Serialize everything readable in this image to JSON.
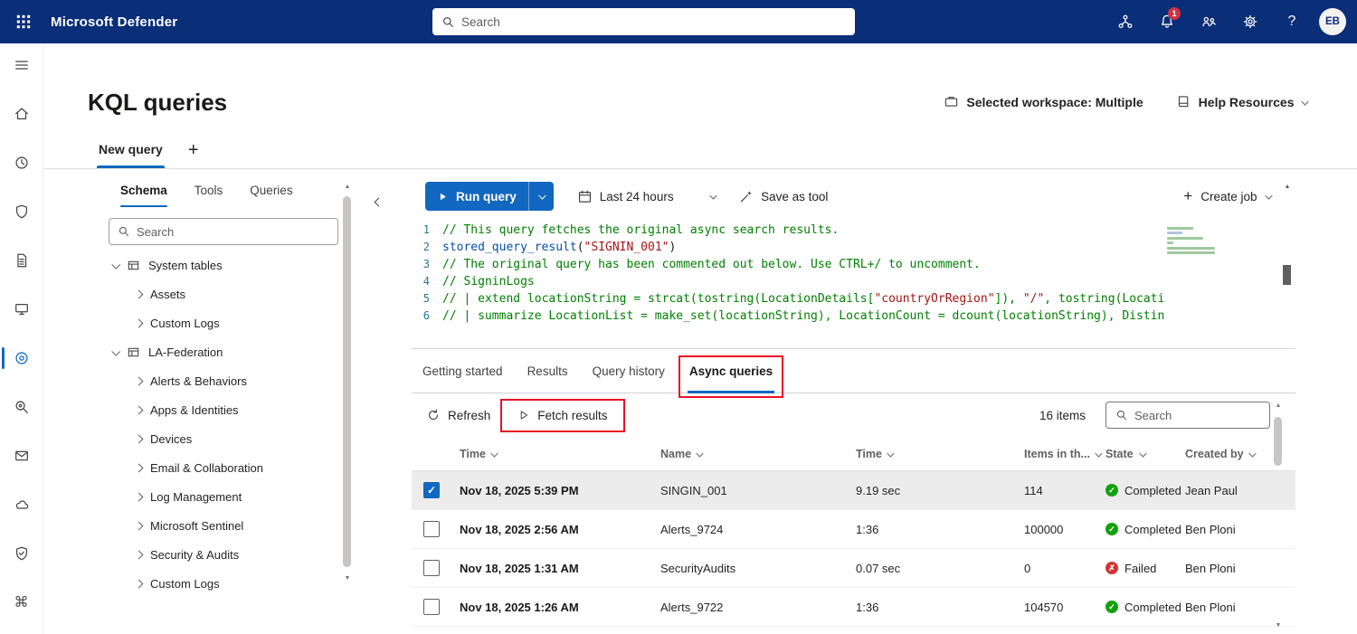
{
  "colors": {
    "header_bg": "#0a2e78",
    "primary": "#1267c1",
    "success": "#13a10e",
    "error": "#d13438",
    "annotation": "#e81123"
  },
  "topbar": {
    "app_title": "Microsoft Defender",
    "search_placeholder": "Search",
    "notification_badge": "1",
    "avatar_initials": "EB"
  },
  "page": {
    "title": "KQL queries",
    "workspace_label": "Selected workspace: Multiple",
    "help_label": "Help Resources",
    "query_tab": "New query"
  },
  "schema_panel": {
    "tabs": [
      {
        "label": "Schema",
        "active": true
      },
      {
        "label": "Tools",
        "active": false
      },
      {
        "label": "Queries",
        "active": false
      }
    ],
    "search_placeholder": "Search",
    "tree": [
      {
        "label": "System tables",
        "level": 1,
        "expanded": true,
        "group": true
      },
      {
        "label": "Assets",
        "level": 2,
        "expanded": false,
        "group": false
      },
      {
        "label": "Custom Logs",
        "level": 2,
        "expanded": false,
        "group": false
      },
      {
        "label": "LA-Federation",
        "level": 1,
        "expanded": true,
        "group": true
      },
      {
        "label": "Alerts & Behaviors",
        "level": 2,
        "expanded": false,
        "group": false
      },
      {
        "label": "Apps & Identities",
        "level": 2,
        "expanded": false,
        "group": false
      },
      {
        "label": "Devices",
        "level": 2,
        "expanded": false,
        "group": false
      },
      {
        "label": "Email & Collaboration",
        "level": 2,
        "expanded": false,
        "group": false
      },
      {
        "label": "Log Management",
        "level": 2,
        "expanded": false,
        "group": false
      },
      {
        "label": "Microsoft Sentinel",
        "level": 2,
        "expanded": false,
        "group": false
      },
      {
        "label": "Security & Audits",
        "level": 2,
        "expanded": false,
        "group": false
      },
      {
        "label": "Custom Logs",
        "level": 2,
        "expanded": false,
        "group": false
      }
    ]
  },
  "editor": {
    "run_query": "Run query",
    "time_range": "Last 24 hours",
    "save_as_tool": "Save as tool",
    "create_job": "Create job",
    "code_lines": [
      {
        "n": 1,
        "seg": [
          [
            "comment",
            "// This query fetches the original async search results."
          ]
        ]
      },
      {
        "n": 2,
        "seg": [
          [
            "function",
            "stored_query_result"
          ],
          [
            "plain",
            "("
          ],
          [
            "string",
            "\"SIGNIN_001\""
          ],
          [
            "plain",
            ")"
          ]
        ]
      },
      {
        "n": 3,
        "seg": [
          [
            "comment",
            "// The original query has been commented out below. Use CTRL+/ to uncomment."
          ]
        ]
      },
      {
        "n": 4,
        "seg": [
          [
            "comment",
            "// SigninLogs"
          ]
        ]
      },
      {
        "n": 5,
        "seg": [
          [
            "comment",
            "// | extend locationString = strcat(tostring(LocationDetails["
          ],
          [
            "string",
            "\"countryOrRegion\""
          ],
          [
            "comment",
            "]), "
          ],
          [
            "string",
            "\"/\""
          ],
          [
            "comment",
            ", tostring(Locati"
          ]
        ]
      },
      {
        "n": 6,
        "seg": [
          [
            "comment",
            "// | summarize LocationList = make_set(locationString), LocationCount = dcount(locationString), Distin"
          ]
        ]
      }
    ]
  },
  "results_panel": {
    "tabs": [
      {
        "label": "Getting started",
        "active": false,
        "annotated": false
      },
      {
        "label": "Results",
        "active": false,
        "annotated": false
      },
      {
        "label": "Query history",
        "active": false,
        "annotated": false
      },
      {
        "label": "Async queries",
        "active": true,
        "annotated": true
      }
    ],
    "refresh": "Refresh",
    "fetch_results": "Fetch results",
    "items_count": "16 items",
    "search_placeholder": "Search",
    "columns": [
      "Time",
      "Name",
      "Time",
      "Items in th...",
      "State",
      "Created by"
    ],
    "rows": [
      {
        "checked": true,
        "selected": true,
        "time": "Nov 18, 2025 5:39 PM",
        "name": "SINGIN_001",
        "duration": "9.19 sec",
        "items": "114",
        "state": "Completed",
        "state_kind": "success",
        "created_by": "Jean Paul"
      },
      {
        "checked": false,
        "selected": false,
        "time": "Nov 18, 2025 2:56 AM",
        "name": "Alerts_9724",
        "duration": "1:36",
        "items": "100000",
        "state": "Completed",
        "state_kind": "success",
        "created_by": "Ben Ploni"
      },
      {
        "checked": false,
        "selected": false,
        "time": "Nov 18, 2025 1:31 AM",
        "name": "SecurityAudits",
        "duration": "0.07 sec",
        "items": "0",
        "state": "Failed",
        "state_kind": "error",
        "created_by": "Ben Ploni"
      },
      {
        "checked": false,
        "selected": false,
        "time": "Nov 18, 2025 1:26 AM",
        "name": "Alerts_9722",
        "duration": "1:36",
        "items": "104570",
        "state": "Completed",
        "state_kind": "success",
        "created_by": "Ben Ploni"
      }
    ]
  }
}
